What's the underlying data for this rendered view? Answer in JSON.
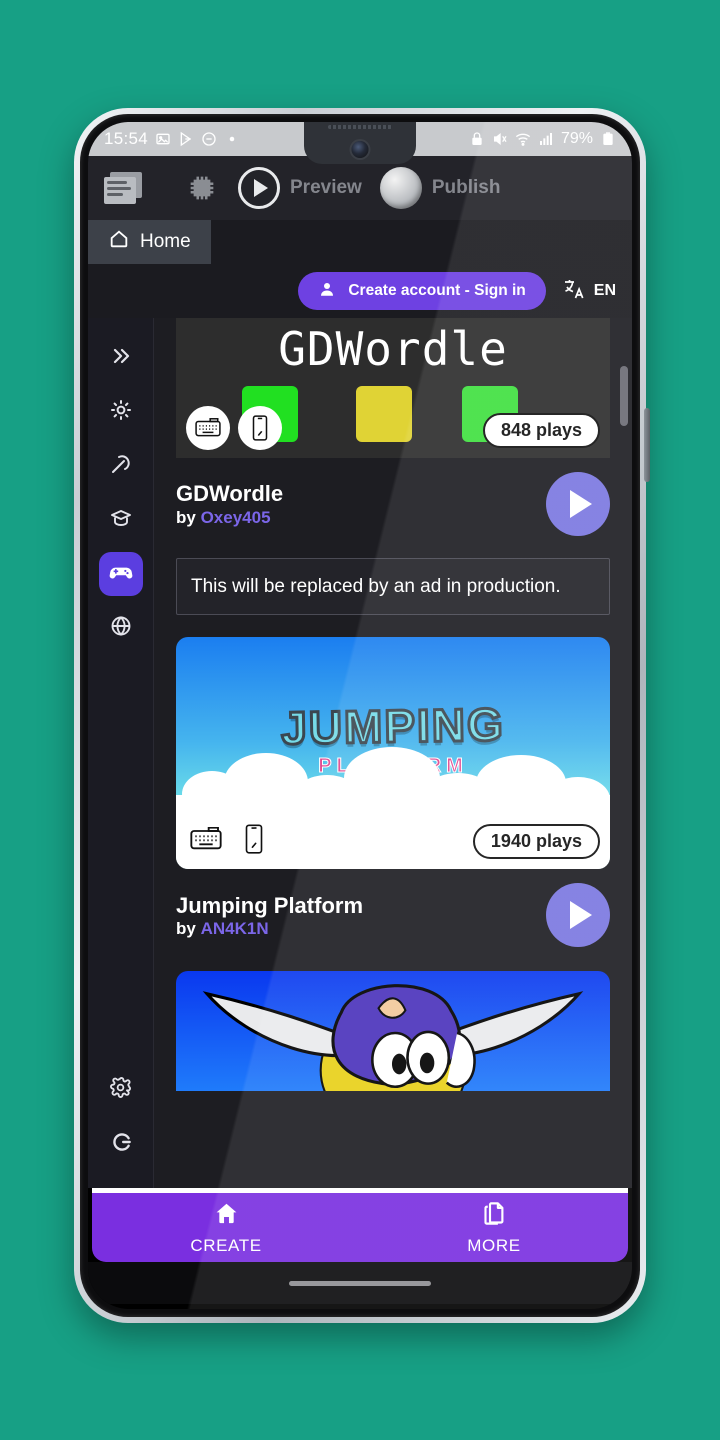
{
  "background_color": "#17a085",
  "status_bar": {
    "time": "15:54",
    "battery_percent": "79%",
    "left_icons": [
      "image-icon",
      "play-store-icon",
      "do-not-disturb-icon",
      "dot-icon"
    ],
    "right_icons": [
      "lock-icon",
      "mute-icon",
      "wifi-icon",
      "signal-icon",
      "battery-icon"
    ]
  },
  "toolbar": {
    "projects_icon": "projects-icon",
    "chip_icon": "chip-icon",
    "preview_label": "Preview",
    "publish_label": "Publish"
  },
  "tabs": [
    {
      "label": "Home",
      "icon": "home-icon",
      "active": true
    }
  ],
  "account_row": {
    "signin_label": "Create account - Sign in",
    "signin_icon": "person-icon",
    "language_icon": "translate-icon",
    "language_label": "EN",
    "accent_color": "#6e41e2"
  },
  "sidebar": {
    "items": [
      {
        "name": "expand",
        "icon": "chevrons-right-icon",
        "active": false
      },
      {
        "name": "get-started",
        "icon": "sun-icon",
        "active": false
      },
      {
        "name": "build",
        "icon": "pickaxe-icon",
        "active": false
      },
      {
        "name": "learn",
        "icon": "graduation-cap-icon",
        "active": false
      },
      {
        "name": "play",
        "icon": "gamepad-icon",
        "active": true
      },
      {
        "name": "community",
        "icon": "globe-icon",
        "active": false
      }
    ],
    "bottom_items": [
      {
        "name": "preferences",
        "icon": "gear-icon",
        "active": false
      },
      {
        "name": "gdevelop-logo",
        "icon": "gdevelop-g-icon",
        "active": false
      }
    ],
    "active_color": "#5b3ee0"
  },
  "content": {
    "ad_placeholder": "This will be replaced by an ad in production.",
    "games": [
      {
        "title": "GDWordle",
        "author_prefix": "by",
        "author": "Oxey405",
        "plays": "848 plays",
        "thumb_title": "GDWordle",
        "thumb_kind": "gdwordle",
        "platform_icons": [
          "keyboard-icon",
          "mobile-icon"
        ],
        "play_button": "play-icon"
      },
      {
        "title": "Jumping Platform",
        "author_prefix": "by",
        "author": "AN4K1N",
        "plays": "1940 plays",
        "thumb_title": "JUMPING",
        "thumb_subtitle": "PLATFORM",
        "thumb_kind": "jumping",
        "platform_icons": [
          "keyboard-icon",
          "mobile-icon"
        ],
        "play_button": "play-icon"
      },
      {
        "title": "",
        "author_prefix": "",
        "author": "",
        "plays": "",
        "thumb_kind": "sonic",
        "platform_icons": [],
        "play_button": "play-icon"
      }
    ],
    "author_color": "#7b66e8",
    "play_button_color": "#7b77e0"
  },
  "bottom_nav": {
    "background_color": "#7a2fe0",
    "items": [
      {
        "label": "CREATE",
        "icon": "home-icon"
      },
      {
        "label": "MORE",
        "icon": "copy-documents-icon"
      }
    ]
  }
}
